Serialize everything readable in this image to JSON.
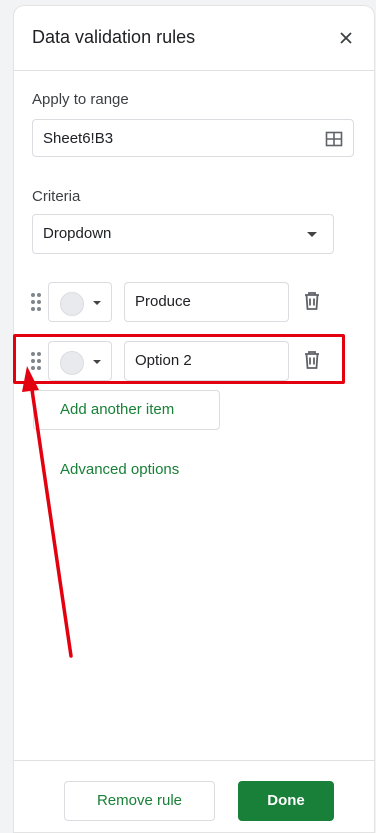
{
  "panel": {
    "title": "Data validation rules",
    "close_icon": "close-icon"
  },
  "range": {
    "label": "Apply to range",
    "value": "Sheet6!B3",
    "icon": "grid-select-icon"
  },
  "criteria": {
    "label": "Criteria",
    "selected": "Dropdown"
  },
  "items": [
    {
      "value": "Produce",
      "color": "#e8eaed"
    },
    {
      "value": "Option 2",
      "color": "#e8eaed"
    }
  ],
  "actions": {
    "add_item": "Add another item",
    "advanced": "Advanced options",
    "remove_rule": "Remove rule",
    "done": "Done"
  },
  "colors": {
    "accent": "#188038",
    "annotation": "#e3000f"
  }
}
